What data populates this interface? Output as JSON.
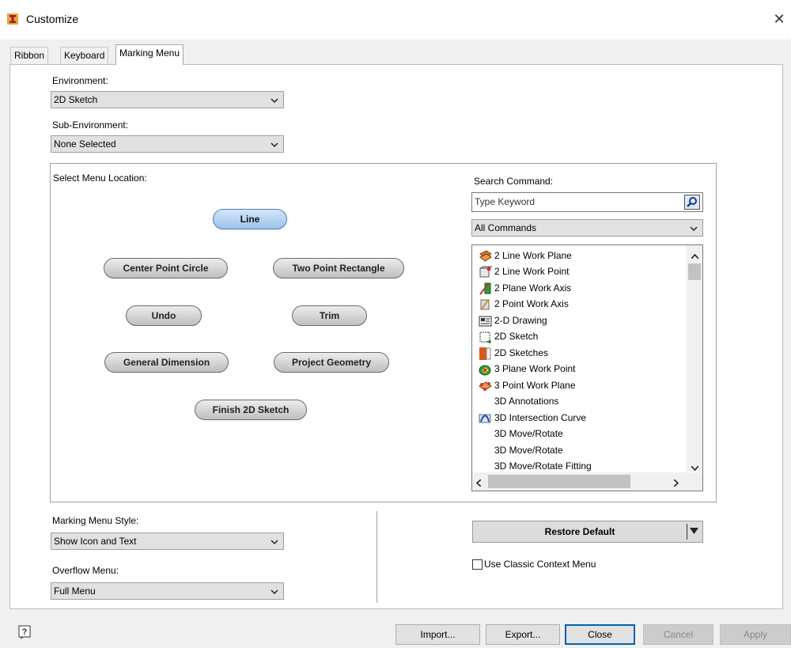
{
  "window": {
    "title": "Customize",
    "close_glyph": "✕"
  },
  "tabs": [
    {
      "label": "Ribbon"
    },
    {
      "label": "Keyboard"
    },
    {
      "label": "Marking Menu"
    }
  ],
  "environment": {
    "label": "Environment:",
    "value": "2D Sketch"
  },
  "sub_environment": {
    "label": "Sub-Environment:",
    "value": "None Selected"
  },
  "menu_location": {
    "label": "Select Menu Location:",
    "items": [
      "Line",
      "Center Point Circle",
      "Two Point Rectangle",
      "Undo",
      "Trim",
      "General Dimension",
      "Project Geometry",
      "Finish 2D Sketch"
    ]
  },
  "search": {
    "label": "Search Command:",
    "placeholder": "Type Keyword",
    "filter": "All Commands"
  },
  "commands": [
    {
      "label": "2 Line Work Plane",
      "icon": "workplane-icon"
    },
    {
      "label": "2 Line Work Point",
      "icon": "workpoint-icon"
    },
    {
      "label": "2 Plane Work Axis",
      "icon": "workaxis-icon"
    },
    {
      "label": "2 Point Work Axis",
      "icon": "workaxis-icon"
    },
    {
      "label": "2-D Drawing",
      "icon": "drawing-icon"
    },
    {
      "label": "2D Sketch",
      "icon": "sketch-icon"
    },
    {
      "label": "2D Sketches",
      "icon": "sketches-icon"
    },
    {
      "label": "3 Plane Work Point",
      "icon": "workpoint-icon"
    },
    {
      "label": "3 Point Work Plane",
      "icon": "workplane-icon"
    },
    {
      "label": "3D Annotations",
      "icon": ""
    },
    {
      "label": "3D Intersection Curve",
      "icon": "intersection-curve-icon"
    },
    {
      "label": "3D Move/Rotate",
      "icon": ""
    },
    {
      "label": "3D Move/Rotate",
      "icon": ""
    },
    {
      "label": "3D Move/Rotate Fitting",
      "icon": ""
    }
  ],
  "style": {
    "label": "Marking Menu Style:",
    "value": "Show Icon and Text"
  },
  "overflow": {
    "label": "Overflow Menu:",
    "value": "Full Menu"
  },
  "restore_label": "Restore Default",
  "classic_context": {
    "label": "Use Classic Context Menu",
    "checked": false
  },
  "footer": {
    "import": "Import...",
    "export": "Export...",
    "close": "Close",
    "cancel": "Cancel",
    "apply": "Apply"
  }
}
